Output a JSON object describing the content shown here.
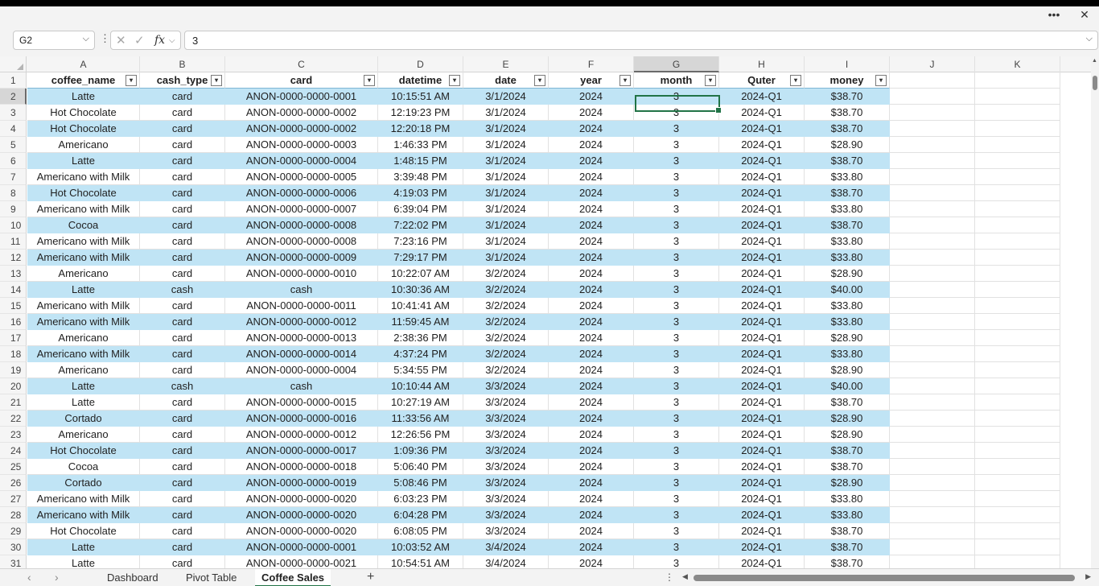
{
  "window": {
    "more_icon": "more-dots-icon",
    "close_icon": "close-icon"
  },
  "formula_bar": {
    "name_box": "G2",
    "formula_value": "3",
    "fx_label": "fx"
  },
  "columns": [
    "A",
    "B",
    "C",
    "D",
    "E",
    "F",
    "G",
    "H",
    "I",
    "J",
    "K"
  ],
  "selected_column": "G",
  "table": {
    "headers": [
      "coffee_name",
      "cash_type",
      "card",
      "datetime",
      "date",
      "year",
      "month",
      "Quter",
      "money"
    ],
    "rows": [
      [
        "Latte",
        "card",
        "ANON-0000-0000-0001",
        "10:15:51 AM",
        "3/1/2024",
        "2024",
        "3",
        "2024-Q1",
        "$38.70"
      ],
      [
        "Hot Chocolate",
        "card",
        "ANON-0000-0000-0002",
        "12:19:23 PM",
        "3/1/2024",
        "2024",
        "3",
        "2024-Q1",
        "$38.70"
      ],
      [
        "Hot Chocolate",
        "card",
        "ANON-0000-0000-0002",
        "12:20:18 PM",
        "3/1/2024",
        "2024",
        "3",
        "2024-Q1",
        "$38.70"
      ],
      [
        "Americano",
        "card",
        "ANON-0000-0000-0003",
        "1:46:33 PM",
        "3/1/2024",
        "2024",
        "3",
        "2024-Q1",
        "$28.90"
      ],
      [
        "Latte",
        "card",
        "ANON-0000-0000-0004",
        "1:48:15 PM",
        "3/1/2024",
        "2024",
        "3",
        "2024-Q1",
        "$38.70"
      ],
      [
        "Americano with Milk",
        "card",
        "ANON-0000-0000-0005",
        "3:39:48 PM",
        "3/1/2024",
        "2024",
        "3",
        "2024-Q1",
        "$33.80"
      ],
      [
        "Hot Chocolate",
        "card",
        "ANON-0000-0000-0006",
        "4:19:03 PM",
        "3/1/2024",
        "2024",
        "3",
        "2024-Q1",
        "$38.70"
      ],
      [
        "Americano with Milk",
        "card",
        "ANON-0000-0000-0007",
        "6:39:04 PM",
        "3/1/2024",
        "2024",
        "3",
        "2024-Q1",
        "$33.80"
      ],
      [
        "Cocoa",
        "card",
        "ANON-0000-0000-0008",
        "7:22:02 PM",
        "3/1/2024",
        "2024",
        "3",
        "2024-Q1",
        "$38.70"
      ],
      [
        "Americano with Milk",
        "card",
        "ANON-0000-0000-0008",
        "7:23:16 PM",
        "3/1/2024",
        "2024",
        "3",
        "2024-Q1",
        "$33.80"
      ],
      [
        "Americano with Milk",
        "card",
        "ANON-0000-0000-0009",
        "7:29:17 PM",
        "3/1/2024",
        "2024",
        "3",
        "2024-Q1",
        "$33.80"
      ],
      [
        "Americano",
        "card",
        "ANON-0000-0000-0010",
        "10:22:07 AM",
        "3/2/2024",
        "2024",
        "3",
        "2024-Q1",
        "$28.90"
      ],
      [
        "Latte",
        "cash",
        "cash",
        "10:30:36 AM",
        "3/2/2024",
        "2024",
        "3",
        "2024-Q1",
        "$40.00"
      ],
      [
        "Americano with Milk",
        "card",
        "ANON-0000-0000-0011",
        "10:41:41 AM",
        "3/2/2024",
        "2024",
        "3",
        "2024-Q1",
        "$33.80"
      ],
      [
        "Americano with Milk",
        "card",
        "ANON-0000-0000-0012",
        "11:59:45 AM",
        "3/2/2024",
        "2024",
        "3",
        "2024-Q1",
        "$33.80"
      ],
      [
        "Americano",
        "card",
        "ANON-0000-0000-0013",
        "2:38:36 PM",
        "3/2/2024",
        "2024",
        "3",
        "2024-Q1",
        "$28.90"
      ],
      [
        "Americano with Milk",
        "card",
        "ANON-0000-0000-0014",
        "4:37:24 PM",
        "3/2/2024",
        "2024",
        "3",
        "2024-Q1",
        "$33.80"
      ],
      [
        "Americano",
        "card",
        "ANON-0000-0000-0004",
        "5:34:55 PM",
        "3/2/2024",
        "2024",
        "3",
        "2024-Q1",
        "$28.90"
      ],
      [
        "Latte",
        "cash",
        "cash",
        "10:10:44 AM",
        "3/3/2024",
        "2024",
        "3",
        "2024-Q1",
        "$40.00"
      ],
      [
        "Latte",
        "card",
        "ANON-0000-0000-0015",
        "10:27:19 AM",
        "3/3/2024",
        "2024",
        "3",
        "2024-Q1",
        "$38.70"
      ],
      [
        "Cortado",
        "card",
        "ANON-0000-0000-0016",
        "11:33:56 AM",
        "3/3/2024",
        "2024",
        "3",
        "2024-Q1",
        "$28.90"
      ],
      [
        "Americano",
        "card",
        "ANON-0000-0000-0012",
        "12:26:56 PM",
        "3/3/2024",
        "2024",
        "3",
        "2024-Q1",
        "$28.90"
      ],
      [
        "Hot Chocolate",
        "card",
        "ANON-0000-0000-0017",
        "1:09:36 PM",
        "3/3/2024",
        "2024",
        "3",
        "2024-Q1",
        "$38.70"
      ],
      [
        "Cocoa",
        "card",
        "ANON-0000-0000-0018",
        "5:06:40 PM",
        "3/3/2024",
        "2024",
        "3",
        "2024-Q1",
        "$38.70"
      ],
      [
        "Cortado",
        "card",
        "ANON-0000-0000-0019",
        "5:08:46 PM",
        "3/3/2024",
        "2024",
        "3",
        "2024-Q1",
        "$28.90"
      ],
      [
        "Americano with Milk",
        "card",
        "ANON-0000-0000-0020",
        "6:03:23 PM",
        "3/3/2024",
        "2024",
        "3",
        "2024-Q1",
        "$33.80"
      ],
      [
        "Americano with Milk",
        "card",
        "ANON-0000-0000-0020",
        "6:04:28 PM",
        "3/3/2024",
        "2024",
        "3",
        "2024-Q1",
        "$33.80"
      ],
      [
        "Hot Chocolate",
        "card",
        "ANON-0000-0000-0020",
        "6:08:05 PM",
        "3/3/2024",
        "2024",
        "3",
        "2024-Q1",
        "$38.70"
      ],
      [
        "Latte",
        "card",
        "ANON-0000-0000-0001",
        "10:03:52 AM",
        "3/4/2024",
        "2024",
        "3",
        "2024-Q1",
        "$38.70"
      ],
      [
        "Latte",
        "card",
        "ANON-0000-0000-0021",
        "10:54:51 AM",
        "3/4/2024",
        "2024",
        "3",
        "2024-Q1",
        "$38.70"
      ]
    ]
  },
  "sheet_tabs": [
    "Dashboard",
    "Pivot Table",
    "Coffee Sales"
  ],
  "active_sheet": "Coffee Sales",
  "colors": {
    "band": "#c0e4f5",
    "accent": "#217346"
  }
}
